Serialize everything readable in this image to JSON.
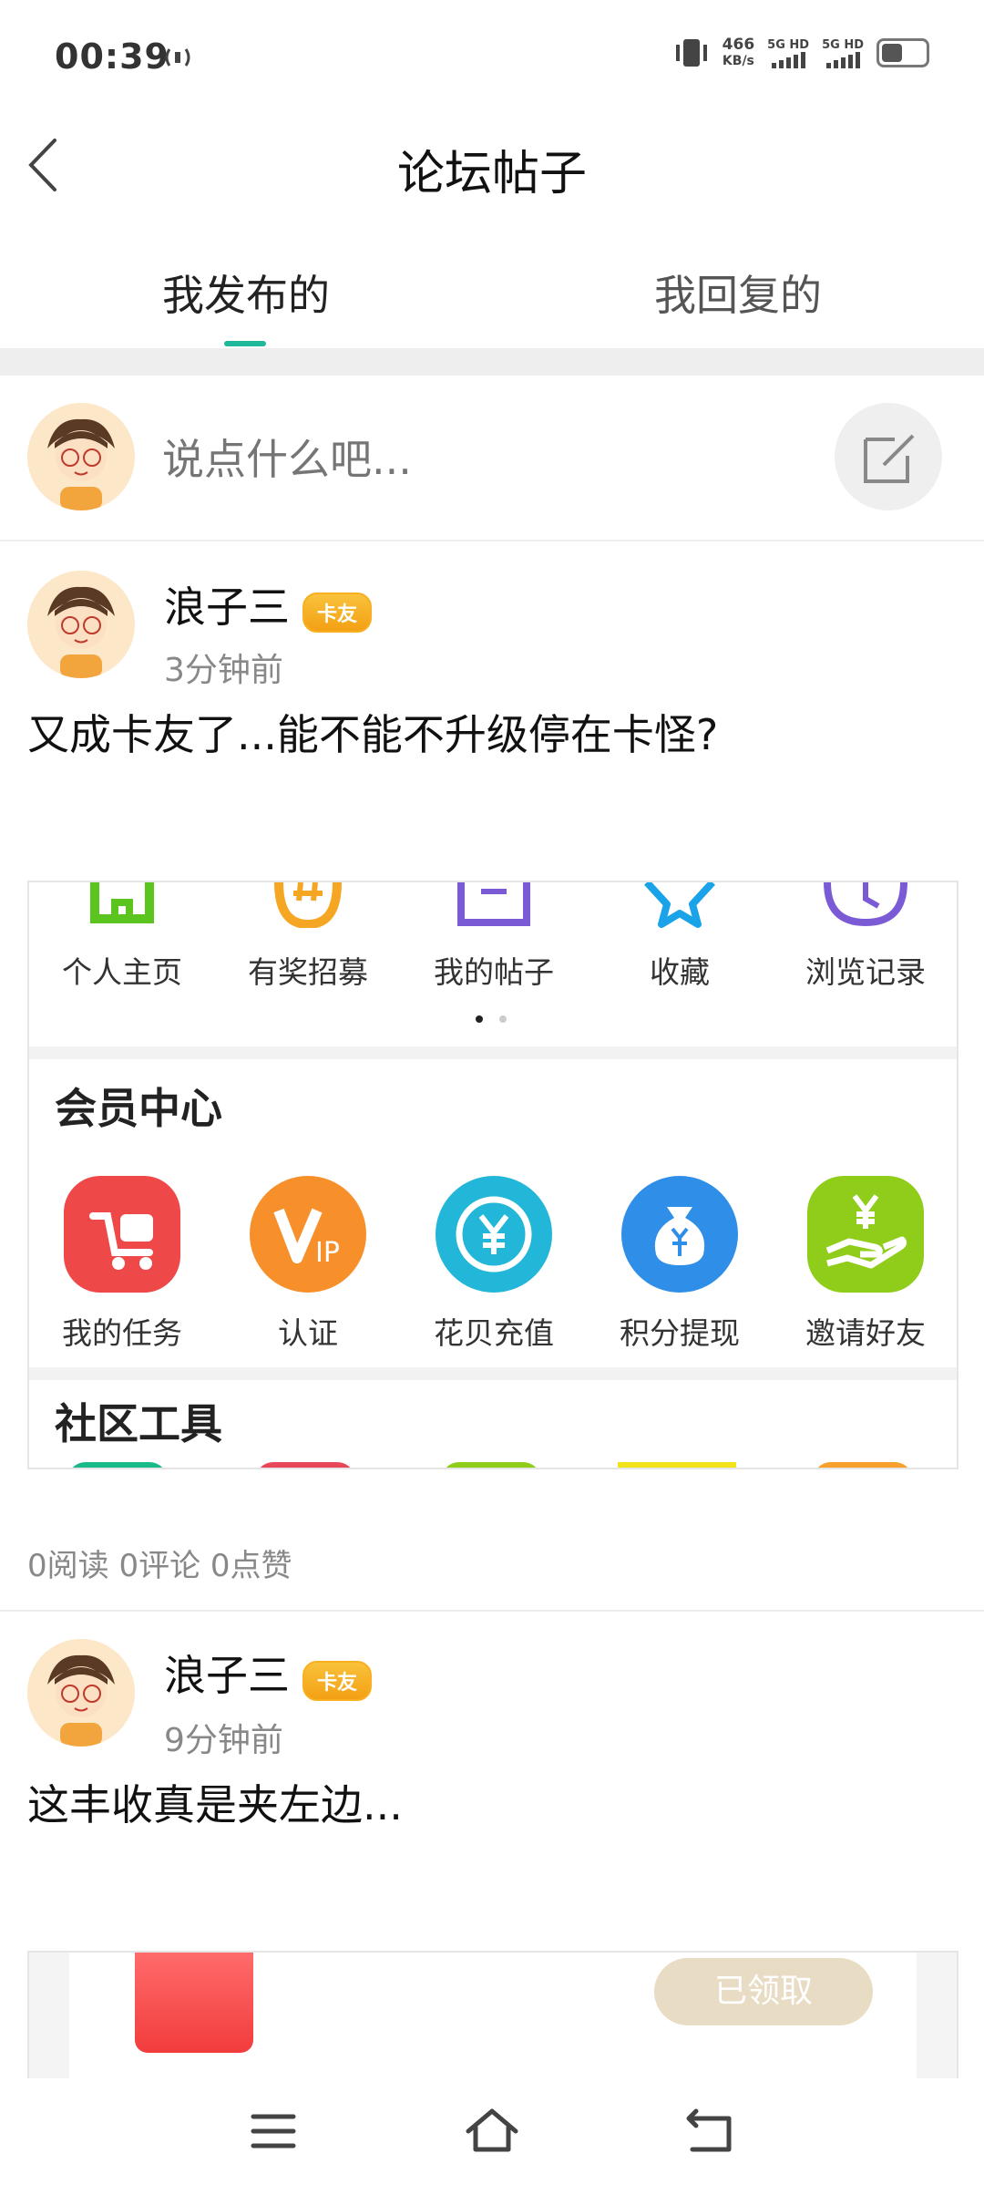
{
  "status": {
    "time": "00:39",
    "net_speed_value": "466",
    "net_speed_unit": "KB/s",
    "sim1": "5G HD",
    "sim2": "5G HD"
  },
  "header": {
    "title": "论坛帖子",
    "back_icon": "chevron-left-icon"
  },
  "tabs": [
    {
      "label": "我发布的",
      "active": true
    },
    {
      "label": "我回复的",
      "active": false
    }
  ],
  "composer": {
    "placeholder": "说点什么吧...",
    "edit_icon": "edit-icon"
  },
  "posts": [
    {
      "author": "浪子三",
      "badge": "卡友",
      "time": "3分钟前",
      "text": "又成卡友了...能不能不升级停在卡怪?",
      "stats": "0阅读 0评论 0点赞",
      "image": {
        "menu_items": [
          "个人主页",
          "有奖招募",
          "我的帖子",
          "收藏",
          "浏览记录"
        ],
        "section1_title": "会员中心",
        "member_items": [
          "我的任务",
          "认证",
          "花贝充值",
          "积分提现",
          "邀请好友"
        ],
        "vip_text": "IP",
        "section2_title": "社区工具"
      }
    },
    {
      "author": "浪子三",
      "badge": "卡友",
      "time": "9分钟前",
      "text": "这丰收真是夹左边...",
      "image": {
        "claim_button": "已领取"
      }
    }
  ],
  "colors": {
    "accent": "#1fb89a",
    "badge": "#f3a014"
  }
}
